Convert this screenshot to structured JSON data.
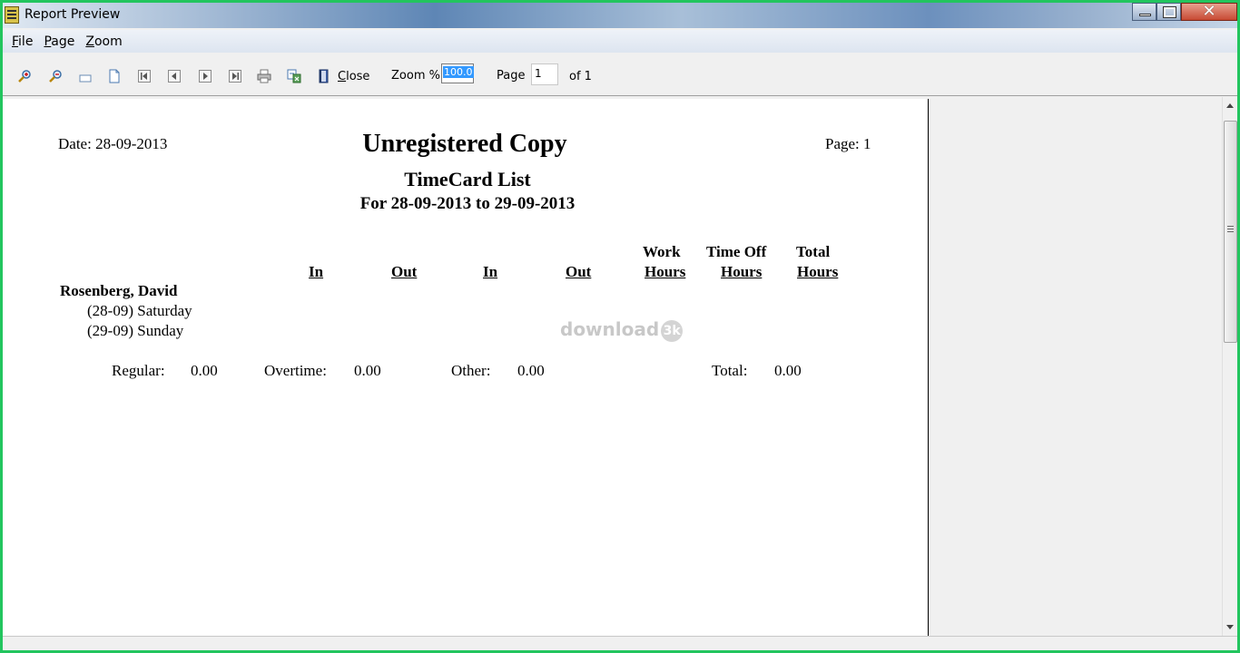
{
  "window": {
    "title": "Report Preview",
    "controls": {
      "minimize": "minimize",
      "maximize": "maximize",
      "close": "✕"
    }
  },
  "menu": {
    "items": [
      {
        "label_u": "F",
        "label_rest": "ile"
      },
      {
        "label_u": "P",
        "label_rest": "age"
      },
      {
        "label_u": "Z",
        "label_rest": "oom"
      }
    ]
  },
  "toolbar": {
    "icons": [
      "zoom-in-icon",
      "zoom-out-icon",
      "page-width-icon",
      "whole-page-icon",
      "first-page-icon",
      "previous-page-icon",
      "next-page-icon",
      "last-page-icon",
      "print-icon",
      "export-icon",
      "close-book-icon"
    ],
    "close_u": "C",
    "close_rest": "lose",
    "zoom_label": "Zoom %",
    "zoom_value": "100.0",
    "page_label": "Page",
    "page_value": "1",
    "of_label": "of 1"
  },
  "report": {
    "date": "Date:  28-09-2013",
    "page": "Page:  1",
    "title": "Unregistered  Copy",
    "subtitle": "TimeCard  List",
    "range": "For 28-09-2013  to  29-09-2013",
    "headers": {
      "in1": "In",
      "out1": "Out",
      "in2": "In",
      "out2": "Out",
      "work_top": "Work",
      "work_bottom": "Hours",
      "timeoff_top": "Time  Off",
      "timeoff_bottom": "Hours",
      "total_top": "Total",
      "total_bottom": "Hours"
    },
    "employee": "Rosenberg,  David",
    "days": [
      "(28-09)  Saturday",
      "(29-09)  Sunday"
    ],
    "summary": {
      "regular_label": "Regular:",
      "regular_value": "0.00",
      "overtime_label": "Overtime:",
      "overtime_value": "0.00",
      "other_label": "Other:",
      "other_value": "0.00",
      "total_label": "Total:",
      "total_value": "0.00"
    },
    "watermark": "download",
    "watermark_badge": "3k"
  }
}
